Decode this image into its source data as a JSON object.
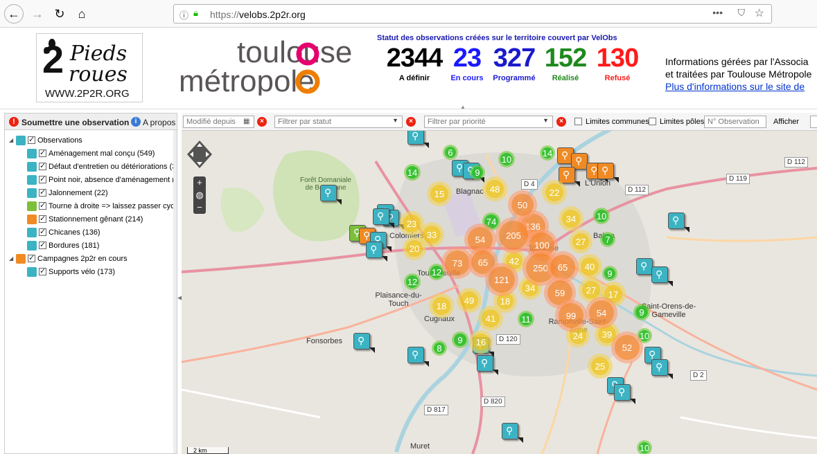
{
  "browser": {
    "url_scheme": "https://",
    "url_host": "velobs.2p2r.org"
  },
  "header": {
    "logo_text_line1": "Pieds",
    "logo_text_line2": "roues",
    "logo_url": "WWW.2P2R.ORG",
    "tm_logo_line1": "toulouse",
    "tm_logo_line2": "métropole",
    "stats_title": "Statut des observations créées sur le territoire couvert par VelObs",
    "stats": [
      {
        "value": "2344",
        "label": "A définir",
        "color": "#000000"
      },
      {
        "value": "23",
        "label": "En cours",
        "color": "#1a1aff"
      },
      {
        "value": "327",
        "label": "Programmé",
        "color": "#1a1acc"
      },
      {
        "value": "152",
        "label": "Réalisé",
        "color": "#1e8a1e"
      },
      {
        "value": "130",
        "label": "Refusé",
        "color": "#ff1a1a"
      }
    ],
    "info_line1": "Informations gérées par l'Associa",
    "info_line2": "et traitées par Toulouse Métropole",
    "info_link": "Plus d'informations sur le site de"
  },
  "left_panel": {
    "submit_label": "Soumettre une observation",
    "about_label": "A propos",
    "layers": [
      {
        "label": "Observations",
        "level": 0,
        "color": "#3bb3c3"
      },
      {
        "label": "Aménagement mal conçu (549)",
        "level": 1,
        "color": "#3bb3c3"
      },
      {
        "label": "Défaut d'entretien ou détériorations (3",
        "level": 1,
        "color": "#3bb3c3"
      },
      {
        "label": "Point noir, absence d'aménagement (5",
        "level": 1,
        "color": "#3bb3c3"
      },
      {
        "label": "Jalonnement (22)",
        "level": 1,
        "color": "#3bb3c3"
      },
      {
        "label": "Tourne à droite => laissez passer cycl",
        "level": 1,
        "color": "#7cbf3a"
      },
      {
        "label": "Stationnement gênant (214)",
        "level": 1,
        "color": "#f08a24"
      },
      {
        "label": "Chicanes (136)",
        "level": 1,
        "color": "#3bb3c3"
      },
      {
        "label": "Bordures (181)",
        "level": 1,
        "color": "#3bb3c3"
      },
      {
        "label": "Campagnes 2p2r en cours",
        "level": 0,
        "color": "#f08a24"
      },
      {
        "label": "Supports vélo (173)",
        "level": 1,
        "color": "#3bb3c3"
      }
    ]
  },
  "filters": {
    "modified_placeholder": "Modifié depuis",
    "status_placeholder": "Filtrer par statut",
    "priority_placeholder": "Filtrer par priorité",
    "limits_communes": "Limites communes",
    "limits_poles": "Limites pôles",
    "obs_placeholder": "N° Observation",
    "show_label": "Afficher"
  },
  "map": {
    "clusters": [
      {
        "n": "6",
        "c": "green"
      },
      {
        "n": "14",
        "c": "green"
      },
      {
        "n": "10",
        "c": "green"
      },
      {
        "n": "9",
        "c": "green"
      },
      {
        "n": "14",
        "c": "green"
      },
      {
        "n": "10",
        "c": "green"
      },
      {
        "n": "7",
        "c": "green"
      },
      {
        "n": "74",
        "c": "green"
      },
      {
        "n": "10",
        "c": "green"
      },
      {
        "n": "12",
        "c": "green"
      },
      {
        "n": "12",
        "c": "green"
      },
      {
        "n": "9",
        "c": "green"
      },
      {
        "n": "11",
        "c": "green"
      },
      {
        "n": "9",
        "c": "green"
      },
      {
        "n": "8",
        "c": "green"
      },
      {
        "n": "9",
        "c": "green"
      },
      {
        "n": "10",
        "c": "green"
      },
      {
        "n": "15",
        "c": "yellow"
      },
      {
        "n": "48",
        "c": "yellow"
      },
      {
        "n": "22",
        "c": "yellow"
      },
      {
        "n": "23",
        "c": "yellow"
      },
      {
        "n": "33",
        "c": "yellow"
      },
      {
        "n": "20",
        "c": "yellow"
      },
      {
        "n": "34",
        "c": "yellow"
      },
      {
        "n": "27",
        "c": "yellow"
      },
      {
        "n": "42",
        "c": "yellow"
      },
      {
        "n": "40",
        "c": "yellow"
      },
      {
        "n": "34",
        "c": "yellow"
      },
      {
        "n": "27",
        "c": "yellow"
      },
      {
        "n": "17",
        "c": "yellow"
      },
      {
        "n": "18",
        "c": "yellow"
      },
      {
        "n": "49",
        "c": "yellow"
      },
      {
        "n": "18",
        "c": "yellow"
      },
      {
        "n": "41",
        "c": "yellow"
      },
      {
        "n": "24",
        "c": "yellow"
      },
      {
        "n": "39",
        "c": "yellow"
      },
      {
        "n": "25",
        "c": "yellow"
      },
      {
        "n": "16",
        "c": "yellow"
      },
      {
        "n": "136",
        "c": "orange"
      },
      {
        "n": "54",
        "c": "orange"
      },
      {
        "n": "205",
        "c": "orange"
      },
      {
        "n": "100",
        "c": "orange"
      },
      {
        "n": "73",
        "c": "orange"
      },
      {
        "n": "65",
        "c": "orange"
      },
      {
        "n": "250",
        "c": "orange"
      },
      {
        "n": "65",
        "c": "orange"
      },
      {
        "n": "121",
        "c": "orange"
      },
      {
        "n": "59",
        "c": "orange"
      },
      {
        "n": "99",
        "c": "orange"
      },
      {
        "n": "54",
        "c": "orange"
      },
      {
        "n": "52",
        "c": "orange"
      },
      {
        "n": "50",
        "c": "orange"
      }
    ],
    "roads": [
      "D 4",
      "D 112",
      "D 112",
      "D 119",
      "D 120",
      "D 820",
      "D 817",
      "D 2"
    ],
    "places": [
      "Forêt Domaniale de Bouconne",
      "Blagnac",
      "Colomiers",
      "Tournefeuille",
      "Plaisance-du-Touch",
      "Fonsorbes",
      "Cugnaux",
      "Ramonville-Saint-Agne",
      "Saint-Orens-de-Gameville",
      "Muret",
      "L'Union",
      "Balma",
      "Toulouse"
    ],
    "scale": "2 km"
  }
}
